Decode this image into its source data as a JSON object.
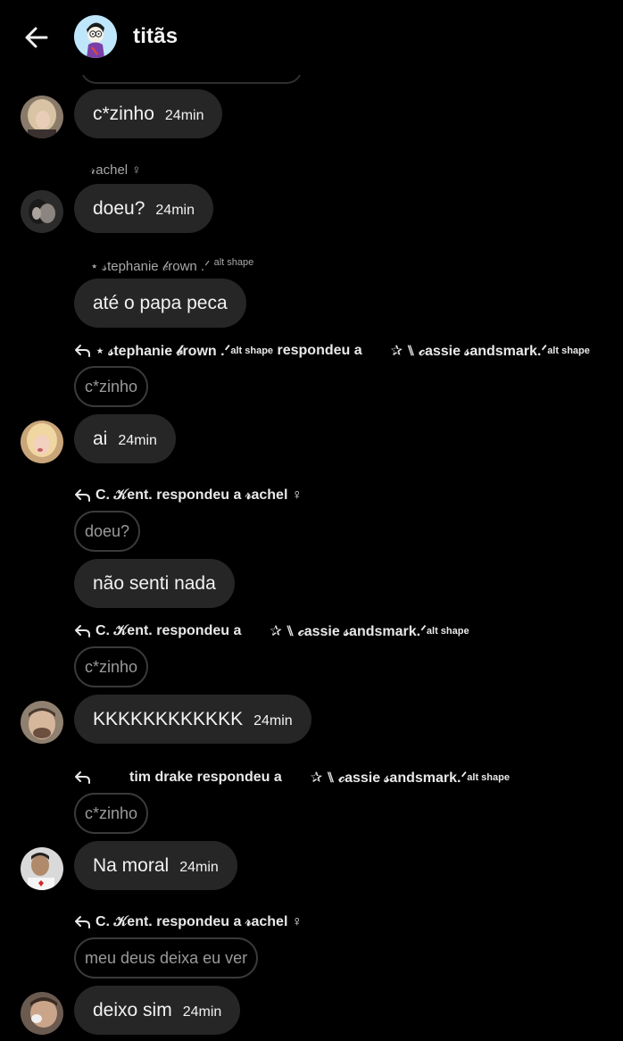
{
  "header": {
    "title": "titãs"
  },
  "messages": [
    {
      "text": "c*zinho",
      "time": "24min"
    },
    {
      "sender": "𝓇achel ♀",
      "text": "doeu?",
      "time": "24min"
    },
    {
      "sender": "⋆ 𝓈tephanie 𝒷rown .ᐟ",
      "sender_sup": "alt shape",
      "text": "até o papa peca"
    },
    {
      "reply_from": "⋆ 𝓈tephanie 𝒷rown .ᐟ",
      "reply_from_sup": "alt shape",
      "reply_verb": "respondeu a",
      "reply_to": "✰ ⑊ 𝒸assie 𝓈andsmark.ᐟ",
      "reply_to_sup": "alt shape",
      "quote": "c*zinho",
      "text": "ai",
      "time": "24min"
    },
    {
      "reply_from": "C. 𝒦ent.",
      "reply_verb": "respondeu a",
      "reply_to": "𝓇achel ♀",
      "quote": "doeu?",
      "text": "não senti nada"
    },
    {
      "reply_from": "C. 𝒦ent.",
      "reply_verb": "respondeu a",
      "reply_to": "✰ ⑊ 𝒸assie 𝓈andsmark.ᐟ",
      "reply_to_sup": "alt shape",
      "quote": "c*zinho",
      "text": "KKKKKKKKKKKK",
      "time": "24min"
    },
    {
      "reply_from": "tim drake",
      "reply_verb": "respondeu a",
      "reply_to": "✰ ⑊ 𝒸assie 𝓈andsmark.ᐟ",
      "reply_to_sup": "alt shape",
      "quote": "c*zinho",
      "text": "Na moral",
      "time": "24min"
    },
    {
      "reply_from": "C. 𝒦ent.",
      "reply_verb": "respondeu a",
      "reply_to": "𝓇achel ♀",
      "quote": "meu deus deixa eu ver",
      "text": "deixo sim",
      "time": "24min"
    }
  ]
}
